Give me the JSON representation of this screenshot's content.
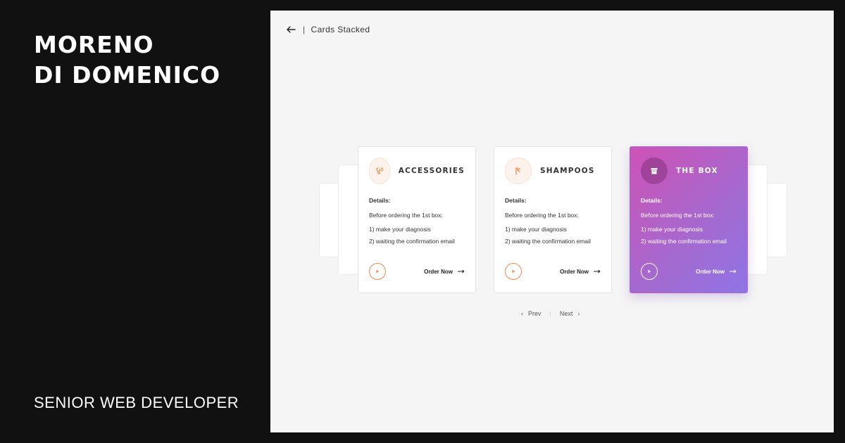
{
  "brand": {
    "name_line1": "MORENO",
    "name_line2": "DI DOMENICO",
    "role": "SENIOR WEB DEVELOPER"
  },
  "preview": {
    "back_icon": "arrow-left-icon",
    "separator": "|",
    "title": "Cards Stacked"
  },
  "cards": [
    {
      "title": "ACCESSORIES",
      "icon": "hairdryer-icon",
      "details_label": "Details:",
      "intro": "Before ordering the 1st box:",
      "item1": "1) make your diagnosis",
      "item2": "2) waiting the confirmation email",
      "cta": "Order Now"
    },
    {
      "title": "SHAMPOOS",
      "icon": "bottle-icon",
      "details_label": "Details:",
      "intro": "Before ordering the 1st box:",
      "item1": "1) make your diagnosis",
      "item2": "2) waiting the confirmation email",
      "cta": "Order Now"
    },
    {
      "title": "THE BOX",
      "icon": "box-icon",
      "details_label": "Details:",
      "intro": "Before ordering the 1st box:",
      "item1": "1) make your diagnosis",
      "item2": "2) waiting the confirmation email",
      "cta": "Order Now"
    }
  ],
  "pager": {
    "prev_chevron": "‹",
    "prev": "Prev",
    "divider": "|",
    "next": "Next",
    "next_chevron": "›"
  },
  "colors": {
    "accent_orange": "#f08a4b",
    "gradient_start": "#cf52b6",
    "gradient_end": "#8f74e6",
    "background_dark": "#111111",
    "preview_bg": "#f5f5f5"
  }
}
